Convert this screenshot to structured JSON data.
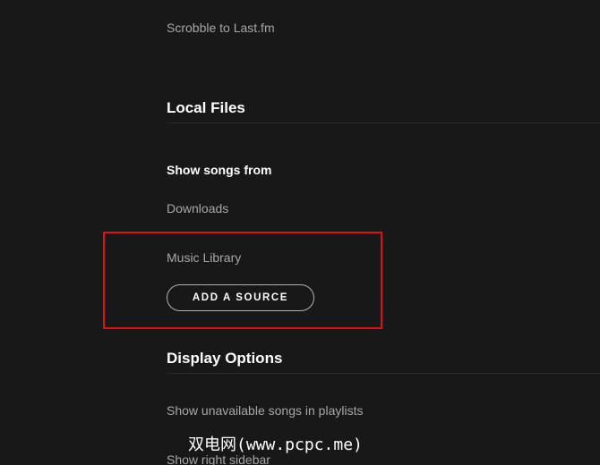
{
  "settings": {
    "scrobble_label": "Scrobble to Last.fm",
    "local_files": {
      "title": "Local Files",
      "show_songs_from": "Show songs from",
      "sources": [
        "Downloads",
        "Music Library"
      ],
      "add_source_label": "ADD A SOURCE"
    },
    "display_options": {
      "title": "Display Options",
      "show_unavailable": "Show unavailable songs in playlists",
      "show_right_sidebar": "Show right sidebar"
    }
  },
  "watermark": "双电网(www.pcpc.me)",
  "colors": {
    "background": "#181818",
    "highlight": "#e0100f",
    "muted_text": "#a7a7a7",
    "title_text": "#ffffff"
  }
}
